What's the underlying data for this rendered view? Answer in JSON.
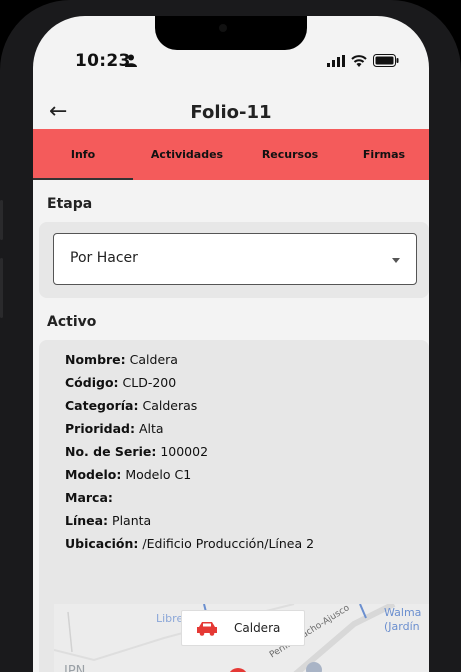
{
  "status_bar": {
    "time": "10:23"
  },
  "appbar": {
    "title": "Folio-11"
  },
  "tabs": [
    {
      "label": "Info",
      "active": true
    },
    {
      "label": "Actividades"
    },
    {
      "label": "Recursos"
    },
    {
      "label": "Firmas"
    }
  ],
  "etapa": {
    "label": "Etapa",
    "selected": "Por Hacer"
  },
  "activo": {
    "label": "Activo",
    "fields": [
      {
        "key": "Nombre:",
        "value": "Caldera"
      },
      {
        "key": "Código:",
        "value": "CLD-200"
      },
      {
        "key": "Categoría:",
        "value": "Calderas"
      },
      {
        "key": "Prioridad:",
        "value": "Alta"
      },
      {
        "key": "No. de Serie:",
        "value": "100002"
      },
      {
        "key": "Modelo:",
        "value": "Modelo C1"
      },
      {
        "key": "Marca:",
        "value": ""
      },
      {
        "key": "Línea:",
        "value": "Planta"
      },
      {
        "key": "Ubicación:",
        "value": "/Edificio Producción/Línea 2"
      }
    ]
  },
  "map": {
    "marker_label": "Caldera",
    "labels": [
      "Libre",
      "Walma",
      "(Jardín",
      "IPN",
      "Perif. Picacho-Ajusco"
    ]
  },
  "colors": {
    "accent": "#f45b5b"
  }
}
